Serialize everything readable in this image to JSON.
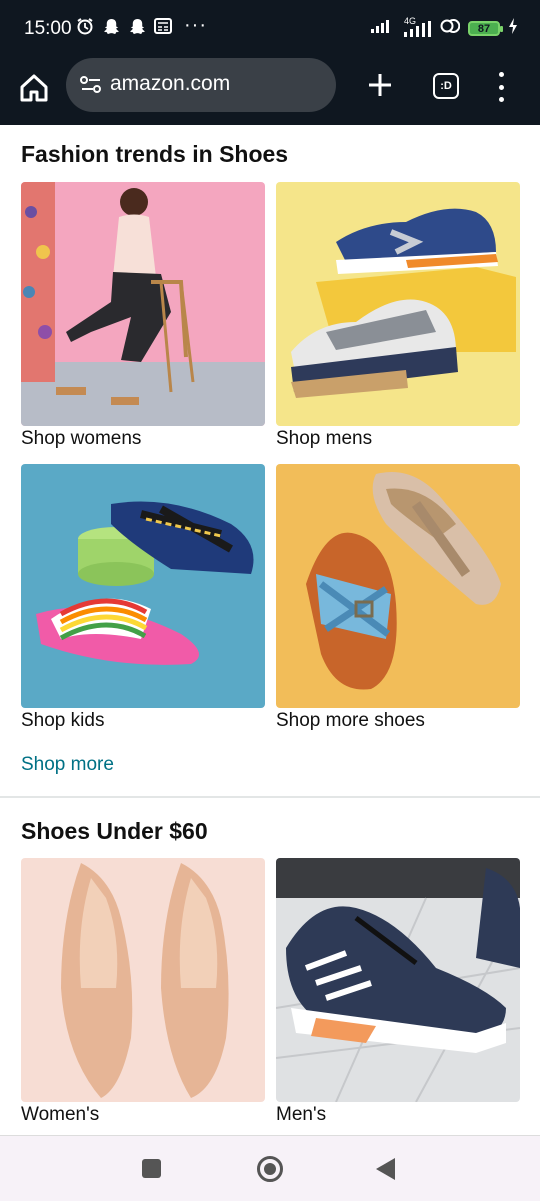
{
  "status_bar": {
    "time": "15:00",
    "more": "···",
    "network": "4G",
    "battery": "87",
    "left_icons": [
      "alarm-icon",
      "snapchat-icon",
      "snapchat-icon",
      "news-icon"
    ],
    "right_icons": [
      "signal-icon",
      "signal-4g-icon",
      "sync-icon",
      "battery-icon",
      "charging-icon"
    ]
  },
  "browser": {
    "url": "amazon.com",
    "tab_count": ":D",
    "icons": [
      "home-icon",
      "site-settings-icon",
      "plus-icon",
      "tabs-icon",
      "more-vert-icon"
    ]
  },
  "sections": [
    {
      "title": "Fashion trends in Shoes",
      "tiles": [
        {
          "label": "Shop womens",
          "image": "woman-on-stool-photo"
        },
        {
          "label": "Shop mens",
          "image": "sneakers-photo"
        },
        {
          "label": "Shop kids",
          "image": "kids-sandals-photo"
        },
        {
          "label": "Shop more shoes",
          "image": "sandals-photo"
        }
      ],
      "link": "Shop more"
    },
    {
      "title": "Shoes Under $60",
      "tiles": [
        {
          "label": "Women's",
          "image": "nude-pumps-photo"
        },
        {
          "label": "Men's",
          "image": "running-shoe-photo"
        }
      ]
    }
  ],
  "colors": {
    "bar_bg": "#0f1720",
    "link": "#007185",
    "tile_pink": "#f4a6bf",
    "tile_yellow": "#f5e58a",
    "tile_blue": "#5aa9c6",
    "tile_orange": "#f2bd59"
  },
  "nav": {
    "icons": [
      "recents-icon",
      "home-circle-icon",
      "back-icon"
    ]
  }
}
